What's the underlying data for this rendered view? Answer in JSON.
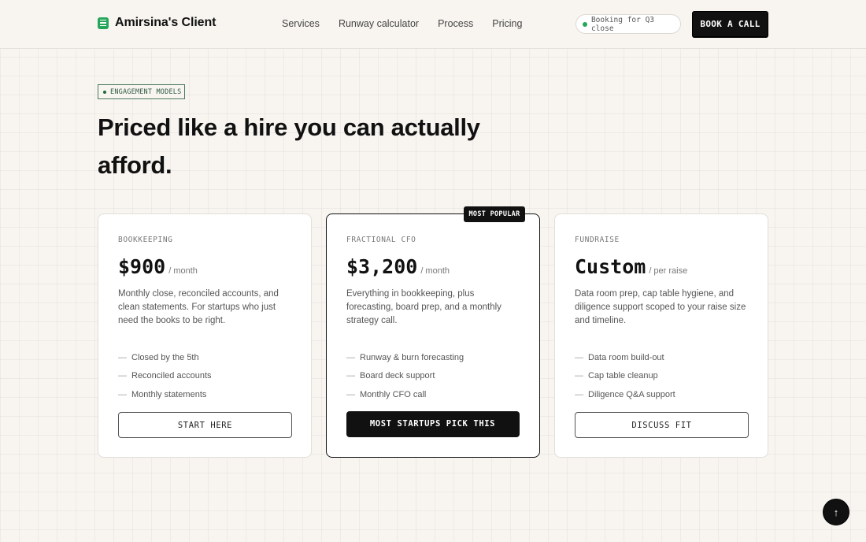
{
  "header": {
    "brand_name": "Amirsina's Client",
    "nav": [
      "Services",
      "Runway calculator",
      "Process",
      "Pricing"
    ],
    "status_pill": "Booking for Q3 close",
    "cta_label": "BOOK A CALL"
  },
  "section": {
    "eyebrow": "ENGAGEMENT MODELS",
    "title": "Priced like a hire you can actually afford."
  },
  "plans": [
    {
      "tier": "BOOKKEEPING",
      "price": "$900",
      "period": "/ month",
      "description": "Monthly close, reconciled accounts, and clean statements. For startups who just need the books to be right.",
      "features": [
        "Closed by the 5th",
        "Reconciled accounts",
        "Monthly statements"
      ],
      "cta": "START HERE"
    },
    {
      "badge": "MOST POPULAR",
      "tier": "FRACTIONAL CFO",
      "price": "$3,200",
      "period": "/ month",
      "description": "Everything in bookkeeping, plus forecasting, board prep, and a monthly strategy call.",
      "features": [
        "Runway & burn forecasting",
        "Board deck support",
        "Monthly CFO call"
      ],
      "cta": "MOST STARTUPS PICK THIS"
    },
    {
      "tier": "FUNDRAISE",
      "price": "Custom",
      "period": "/ per raise",
      "description": "Data room prep, cap table hygiene, and diligence support scoped to your raise size and timeline.",
      "features": [
        "Data room build-out",
        "Cap table cleanup",
        "Diligence Q&A support"
      ],
      "cta": "DISCUSS FIT"
    }
  ],
  "scroll_top_icon": "arrow-up-icon",
  "colors": {
    "accent": "#26a65b",
    "dark": "#111111",
    "background": "#f8f5f1"
  }
}
